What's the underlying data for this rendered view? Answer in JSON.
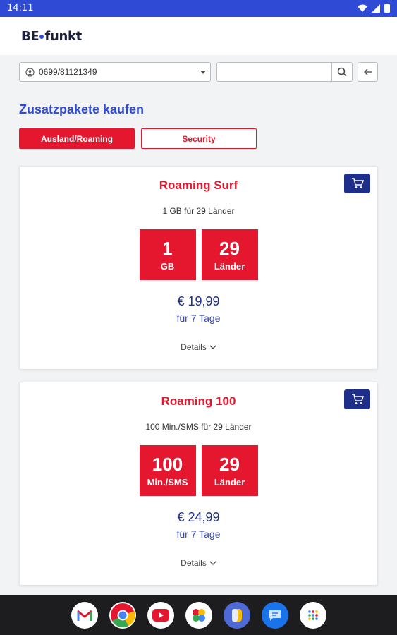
{
  "status": {
    "time": "14:11"
  },
  "app": {
    "logo_left": "BE",
    "logo_right": "funkt"
  },
  "account": {
    "selected_number": "0699/81121349"
  },
  "search": {
    "value": ""
  },
  "page": {
    "title": "Zusatzpakete kaufen"
  },
  "tabs": [
    {
      "label": "Ausland/Roaming",
      "active": true
    },
    {
      "label": "Security",
      "active": false
    }
  ],
  "packages": [
    {
      "title": "Roaming Surf",
      "subtitle": "1 GB für 29 Länder",
      "tiles": [
        {
          "big": "1",
          "small": "GB"
        },
        {
          "big": "29",
          "small": "Länder"
        }
      ],
      "price": "€ 19,99",
      "period": "für 7 Tage",
      "details": "Details"
    },
    {
      "title": "Roaming 100",
      "subtitle": "100 Min./SMS für 29 Länder",
      "tiles": [
        {
          "big": "100",
          "small": "Min./SMS"
        },
        {
          "big": "29",
          "small": "Länder"
        }
      ],
      "price": "€ 24,99",
      "period": "für 7 Tage",
      "details": "Details"
    }
  ],
  "colors": {
    "accent_red": "#e4172e",
    "brand_blue": "#2f4bd6",
    "navy": "#1d2f8a"
  },
  "dock_icons": [
    "gmail-icon",
    "chrome-icon",
    "youtube-icon",
    "photos-icon",
    "bank-app-icon",
    "messages-icon",
    "app-drawer-icon"
  ]
}
